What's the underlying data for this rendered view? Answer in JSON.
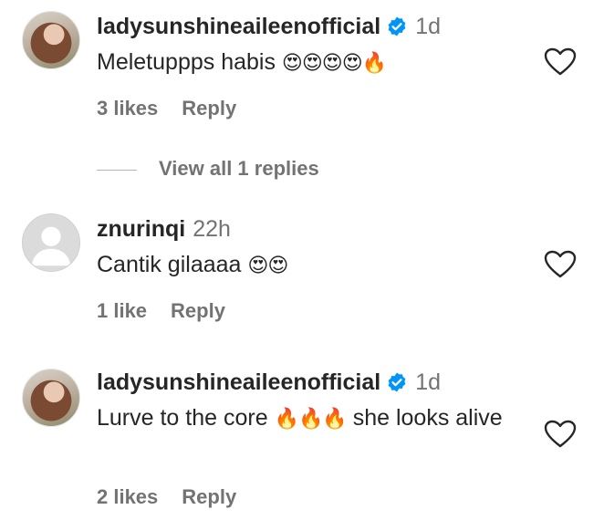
{
  "comments": [
    {
      "username": "ladysunshineaileenofficial",
      "verified": true,
      "time": "1d",
      "text": "Meletuppps habis",
      "emoji": "😍😍😍😍🔥",
      "likes": "3 likes",
      "reply": "Reply",
      "view_replies": "View all 1 replies"
    },
    {
      "username": "znurinqi",
      "verified": false,
      "time": "22h",
      "text": "Cantik gilaaaa",
      "emoji": "😍😍",
      "likes": "1 like",
      "reply": "Reply"
    },
    {
      "username": "ladysunshineaileenofficial",
      "verified": true,
      "time": "1d",
      "text": "Lurve to the core",
      "emoji": "🔥🔥🔥",
      "text_after": "she looks alive",
      "likes": "2 likes",
      "reply": "Reply"
    }
  ],
  "colors": {
    "text": "#262626",
    "secondary": "#737373",
    "verified": "#0095f6"
  },
  "icons": [
    "verified-badge-icon",
    "heart-outline-icon",
    "default-avatar-icon"
  ]
}
